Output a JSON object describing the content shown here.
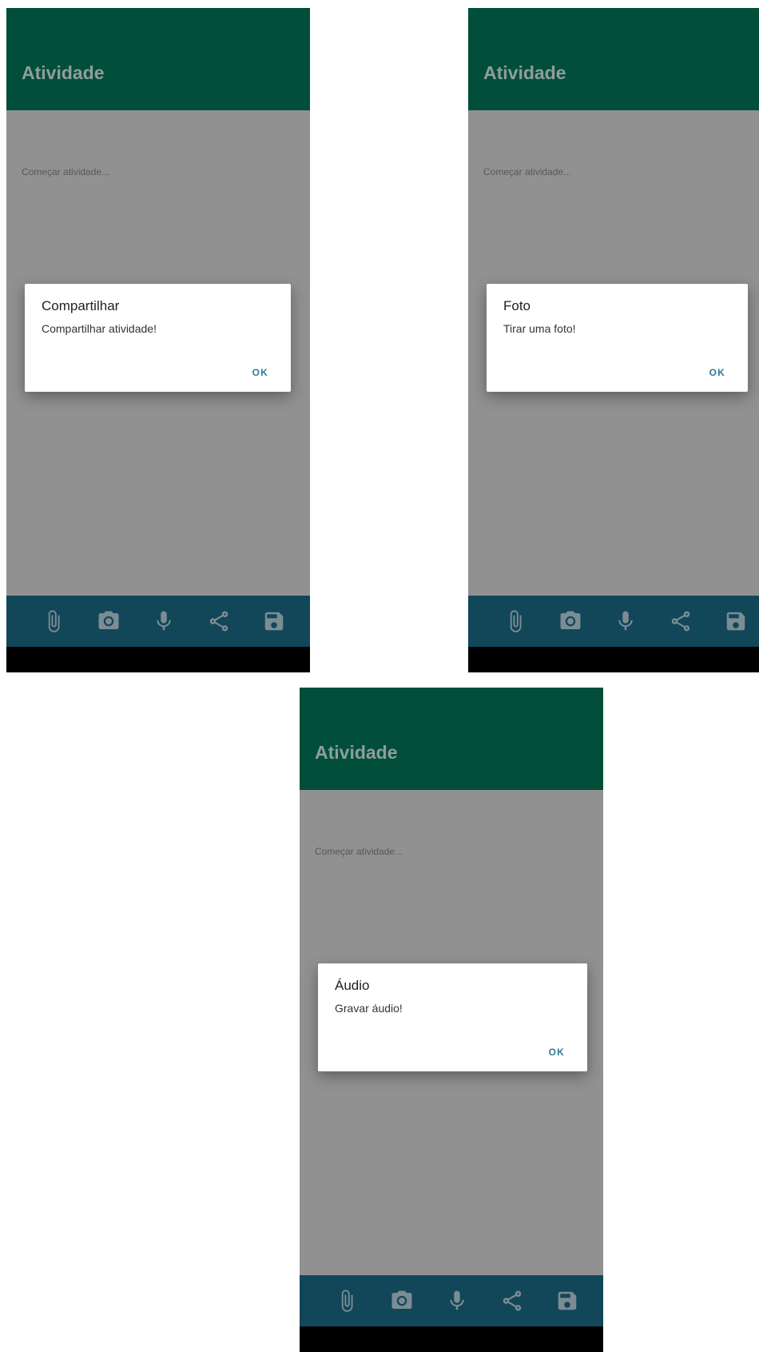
{
  "screens": [
    {
      "app_title": "Atividade",
      "hint": "Começar atividade...",
      "dialog": {
        "title": "Compartilhar",
        "message": "Compartilhar atividade!",
        "ok": "OK"
      }
    },
    {
      "app_title": "Atividade",
      "hint": "Começar atividade...",
      "dialog": {
        "title": "Foto",
        "message": "Tirar uma foto!",
        "ok": "OK"
      }
    },
    {
      "app_title": "Atividade",
      "hint": "Começar atividade...",
      "dialog": {
        "title": "Áudio",
        "message": "Gravar áudio!",
        "ok": "OK"
      }
    }
  ],
  "bottom_bar_icons": [
    "attach-icon",
    "camera-icon",
    "microphone-icon",
    "share-icon",
    "save-icon"
  ],
  "colors": {
    "appbar": "#014e3b",
    "bottombar": "#124659",
    "scrim": "#919191",
    "dialog_button": "#2d7a97"
  }
}
